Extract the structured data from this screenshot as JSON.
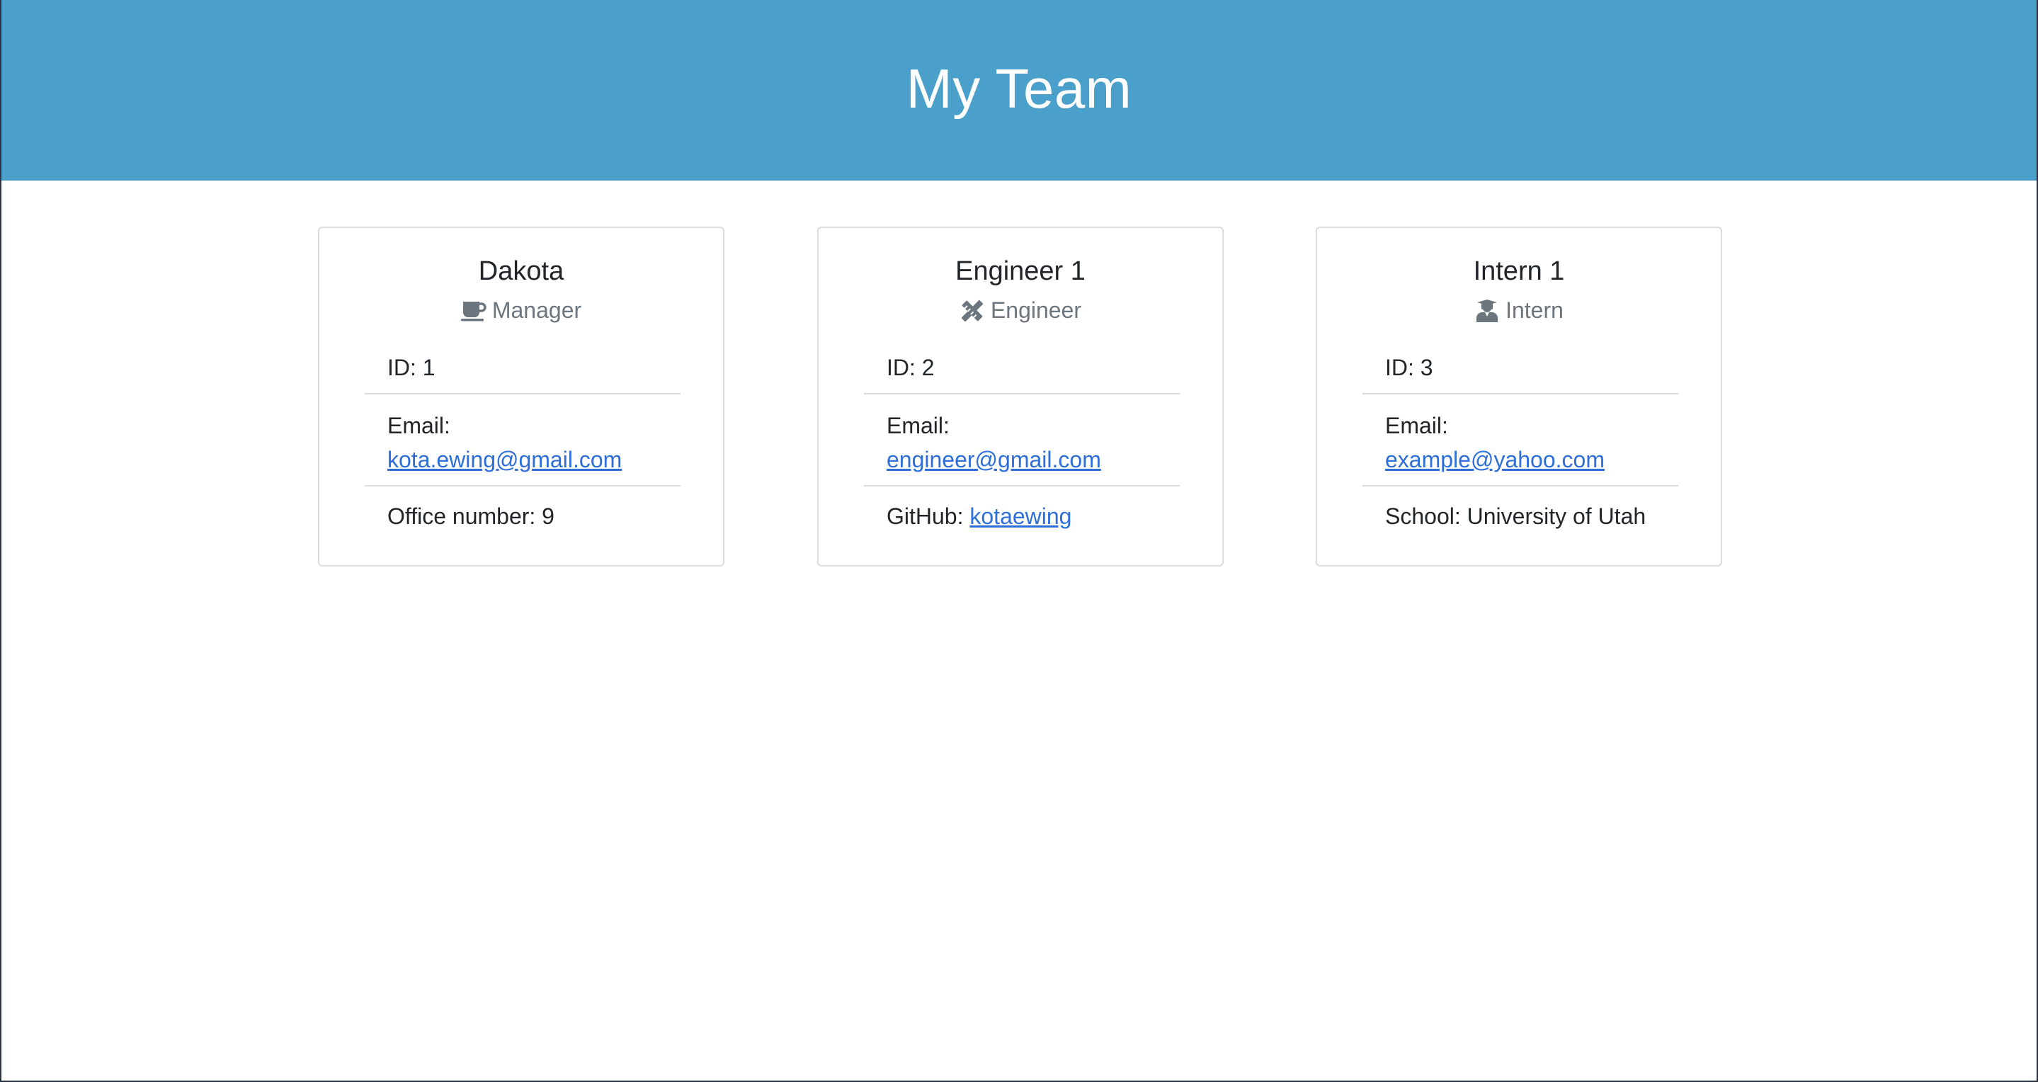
{
  "header": {
    "title": "My Team"
  },
  "cards": [
    {
      "name": "Dakota",
      "role": "Manager",
      "role_icon": "coffee-icon",
      "id_text": "ID: 1",
      "email_label": "Email:",
      "email": "kota.ewing@gmail.com",
      "extra_label": "Office number: 9",
      "extra_link": ""
    },
    {
      "name": "Engineer 1",
      "role": "Engineer",
      "role_icon": "pencil-ruler-icon",
      "id_text": "ID: 2",
      "email_label": "Email:",
      "email": "engineer@gmail.com",
      "extra_label": "GitHub:",
      "extra_link": "kotaewing"
    },
    {
      "name": "Intern 1",
      "role": "Intern",
      "role_icon": "graduate-icon",
      "id_text": "ID: 3",
      "email_label": "Email:",
      "email": "example@yahoo.com",
      "extra_label": "School: University of Utah",
      "extra_link": ""
    }
  ],
  "colors": {
    "header_bg": "#4aa0cb",
    "link": "#2d6ed8",
    "muted": "#6c757d"
  }
}
